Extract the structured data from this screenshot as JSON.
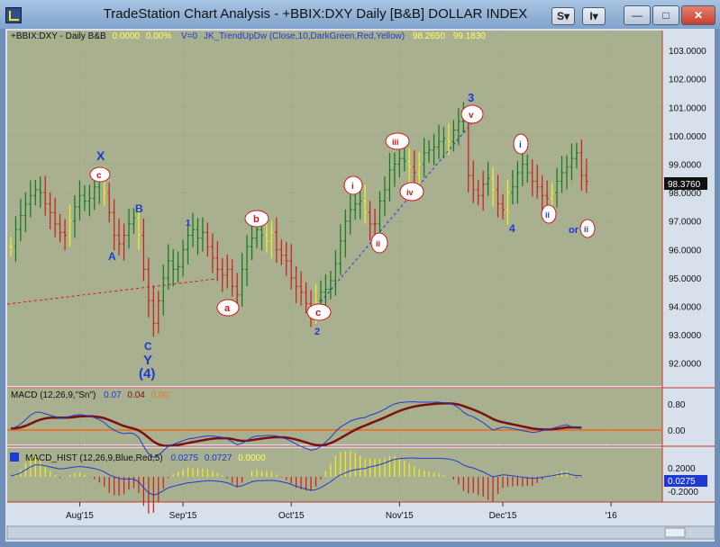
{
  "window": {
    "title": "TradeStation Chart Analysis - +BBIX:DXY Daily [B&B] DOLLAR INDEX",
    "buttons": {
      "s": "S",
      "i": "I"
    }
  },
  "price_panel": {
    "header_symbol": "+BBIX:DXY - Daily  B&B",
    "header_value1": "0.0000",
    "header_value2": "0.00%",
    "header_volume": "V=0",
    "header_indicator": "JK_TrendUpDw (Close,10,DarkGreen,Red,Yellow)",
    "header_ind_val1": "98.2650",
    "header_ind_val2": "99.1830",
    "price_ticks": [
      "103.0000",
      "102.0000",
      "101.0000",
      "100.0000",
      "99.0000",
      "98.0000",
      "97.0000",
      "96.0000",
      "95.0000",
      "94.0000",
      "93.0000",
      "92.0000"
    ],
    "last_price": "98.3760"
  },
  "macd_panel": {
    "label": "MACD (12,26,9,\"Sn\")",
    "val1": "0.07",
    "val2": "0.04",
    "val3": "0.00",
    "ticks": [
      "0.80",
      "0.00"
    ]
  },
  "hist_panel": {
    "label": "MACD_HIST (12,26,9,Blue,Red,5)",
    "val1": "0.0275",
    "val2": "0.0727",
    "val3": "0.0000",
    "ticks": [
      "0.2000",
      "-0.2000"
    ],
    "last_value": "0.0275"
  },
  "xaxis": {
    "labels": [
      "Aug'15",
      "Sep'15",
      "Oct'15",
      "Nov'15",
      "Dec'15",
      "'16"
    ]
  },
  "wave_labels": {
    "x": "X",
    "c1": "c",
    "b_cap": "B",
    "a_cap": "A",
    "c_cap": "C",
    "y": "Y",
    "four_paren": "(4)",
    "one": "1",
    "b": "b",
    "a": "a",
    "c": "c",
    "two": "2",
    "i": "i",
    "ii": "ii",
    "iii": "iii",
    "iv": "iv",
    "v": "v",
    "three": "3",
    "i2": "i",
    "ii2": "ii",
    "four": "4",
    "or": "or",
    "ii3": "ii"
  },
  "colors": {
    "chart_bg": "#a8b08f",
    "green": "#0a7a1a",
    "red": "#d01818",
    "yellow": "#f3f316",
    "blue": "#1e3ad6",
    "darkred": "#7a1010"
  },
  "chart_data": {
    "type": "bar",
    "title": "+BBIX:DXY Daily [B&B] DOLLAR INDEX",
    "x_axis_labels": [
      "Aug'15",
      "Sep'15",
      "Oct'15",
      "Nov'15",
      "Dec'15",
      "'16"
    ],
    "ylim": [
      91.2,
      103.7
    ],
    "closes": [
      96.1,
      96.7,
      97.2,
      97.6,
      97.9,
      98.1,
      98.0,
      97.6,
      97.3,
      96.9,
      96.6,
      96.5,
      97.0,
      97.5,
      97.9,
      97.7,
      97.8,
      98.2,
      98.4,
      98.0,
      97.3,
      96.5,
      96.2,
      96.5,
      96.9,
      97.1,
      96.5,
      95.3,
      94.2,
      93.4,
      94.2,
      95.0,
      95.6,
      95.3,
      95.4,
      96.0,
      96.5,
      96.7,
      96.4,
      96.6,
      96.1,
      95.7,
      95.3,
      95.1,
      95.3,
      94.7,
      94.4,
      95.3,
      96.1,
      96.4,
      96.7,
      96.5,
      96.3,
      96.6,
      96.0,
      95.8,
      95.6,
      95.0,
      94.7,
      94.5,
      94.1,
      93.8,
      94.2,
      94.5,
      94.6,
      94.9,
      95.5,
      96.3,
      97.0,
      97.4,
      97.6,
      97.7,
      97.3,
      96.9,
      96.9,
      97.7,
      98.1,
      98.8,
      99.0,
      99.2,
      99.1,
      98.9,
      98.7,
      99.0,
      99.4,
      99.5,
      99.6,
      99.8,
      99.9,
      99.8,
      100.2,
      100.5,
      100.6,
      98.6,
      98.1,
      97.9,
      98.3,
      98.5,
      98.1,
      97.6,
      97.4,
      98.0,
      98.2,
      98.7,
      99.0,
      98.7,
      98.4,
      98.2,
      97.9,
      97.8,
      98.0,
      98.4,
      98.7,
      98.9,
      99.2,
      99.4,
      98.6,
      98.4
    ],
    "macd": [
      0.05,
      0.1,
      0.2,
      0.35,
      0.5,
      0.6,
      0.6,
      0.55,
      0.5,
      0.45,
      0.4,
      0.42,
      0.46,
      0.5,
      0.52,
      0.5,
      0.46,
      0.42,
      0.35,
      0.25,
      0.1,
      0.0,
      -0.08,
      -0.12,
      -0.1,
      -0.12,
      -0.25,
      -0.55,
      -0.8,
      -0.92,
      -0.85,
      -0.7,
      -0.55,
      -0.48,
      -0.42,
      -0.36,
      -0.3,
      -0.28,
      -0.25,
      -0.22,
      -0.2,
      -0.2,
      -0.22,
      -0.25,
      -0.3,
      -0.4,
      -0.5,
      -0.45,
      -0.35,
      -0.25,
      -0.2,
      -0.2,
      -0.18,
      -0.18,
      -0.2,
      -0.25,
      -0.3,
      -0.38,
      -0.48,
      -0.55,
      -0.62,
      -0.68,
      -0.65,
      -0.55,
      -0.4,
      -0.25,
      -0.05,
      0.1,
      0.2,
      0.3,
      0.36,
      0.4,
      0.42,
      0.5,
      0.55,
      0.62,
      0.7,
      0.8,
      0.88,
      0.92,
      0.94,
      0.95,
      0.95,
      0.94,
      0.94,
      0.94,
      0.94,
      0.94,
      0.92,
      0.9,
      0.85,
      0.75,
      0.6,
      0.5,
      0.45,
      0.35,
      0.25,
      0.12,
      0.0,
      0.05,
      0.1,
      0.08,
      0.05,
      0.02,
      -0.02,
      -0.05,
      -0.08,
      -0.06,
      -0.02,
      0.02,
      0.05,
      0.1,
      0.15,
      0.18,
      0.1,
      0.06,
      0.07
    ],
    "hist_note": "Histogram derived as MACD minus signal"
  }
}
